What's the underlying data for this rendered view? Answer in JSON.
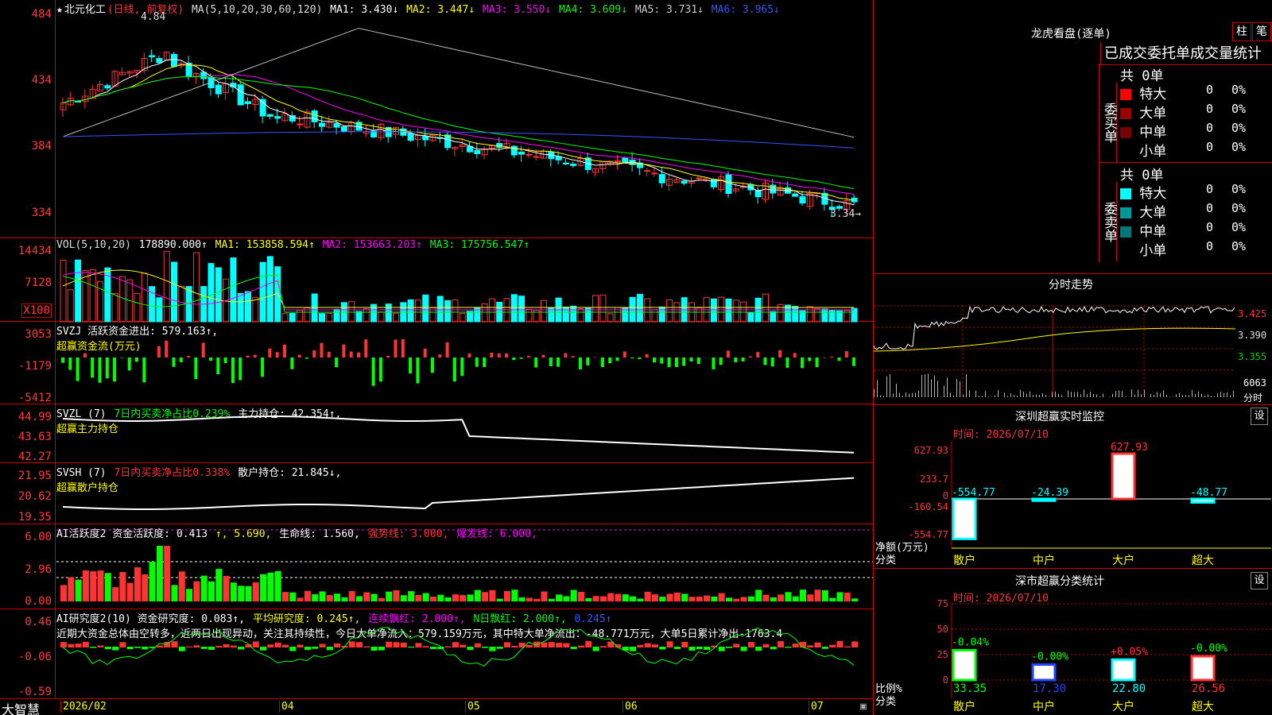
{
  "stock": {
    "name": "北元化工",
    "period": "(日线, 前复权)",
    "ma_label": "MA(5,10,20,30,60,120)",
    "ma_items": [
      {
        "t": "MA1: 3.430↓",
        "c": "#ffffff"
      },
      {
        "t": "MA2: 3.447↓",
        "c": "#ffff00"
      },
      {
        "t": "MA3: 3.550↓",
        "c": "#ff00ff"
      },
      {
        "t": "MA4: 3.609↓",
        "c": "#00ff00"
      },
      {
        "t": "MA5: 3.731↓",
        "c": "#cccccc"
      },
      {
        "t": "MA6: 3.965↓",
        "c": "#3355ff"
      }
    ],
    "hi_label": "4.84",
    "lo_label": "3.34→",
    "yticks": [
      "484",
      "434",
      "384",
      "334"
    ]
  },
  "vol": {
    "label": "VOL(5,10,20)",
    "val": "178890.000↑",
    "items": [
      {
        "t": "MA1: 153858.594↑",
        "c": "#ffff00"
      },
      {
        "t": "MA2: 153663.203↑",
        "c": "#ff00ff"
      },
      {
        "t": "MA3: 175756.547↑",
        "c": "#00ff00"
      }
    ],
    "yticks": [
      "14434",
      "7128"
    ],
    "unit": "X100"
  },
  "svzj": {
    "label": "SVZJ  活跃资金进出: 579.163↑,",
    "sub": "超赢资金流(万元)",
    "yticks": [
      "3053",
      "-1179",
      "-5412"
    ]
  },
  "svzl": {
    "label": "SVZL (7)",
    "green": "7日内买卖净占比0.239%",
    "main": "主力持仓: 42.354↑,",
    "sub": "超赢主力持仓",
    "yticks": [
      "44.99",
      "43.63",
      "42.27"
    ]
  },
  "svsh": {
    "label": "SVSH (7)",
    "red": "7日内买卖净占比0.338%",
    "main": "散户持仓: 21.845↓,",
    "sub": "超赢散户持仓",
    "yticks": [
      "21.95",
      "20.62",
      "19.35"
    ]
  },
  "ai1": {
    "label": "AI活跃度2 资金活跃度: 0.413",
    "items": [
      {
        "t": "↑, 5.690,",
        "c": "#ffff00"
      },
      {
        "t": "生命线: 1.560,",
        "c": "#ffffff"
      },
      {
        "t": "强势线: 3.000,",
        "c": "#ff3333"
      },
      {
        "t": "爆发线: 6.000,",
        "c": "#ff00ff"
      }
    ],
    "yticks": [
      "6.00",
      "2.96",
      "0.00"
    ]
  },
  "ai2": {
    "label": "AI研究度2(10) 资金研究度: 0.083↑,",
    "items": [
      {
        "t": "平均研究度: 0.245↑,",
        "c": "#ffff00"
      },
      {
        "t": "连续飘红: 2.000↑,",
        "c": "#ff00ff"
      },
      {
        "t": "N日飘红: 2.000↑,",
        "c": "#00ff00"
      },
      {
        "t": "0.245↑",
        "c": "#3355ff"
      }
    ],
    "comment": "近期大资金总体由空转多，近两日出现异动，关注其持续性，今日大单净流入：579.159万元，其中特大单净流出：-48.771万元，大单5日累计净出-1763.4",
    "yticks": [
      "0.46",
      "-0.06",
      "-0.59"
    ]
  },
  "xaxis": {
    "brand": "大智慧",
    "labels": [
      "2026/02",
      "04",
      "05",
      "06",
      "07"
    ]
  },
  "lhb": {
    "title": "龙虎看盘(逐单)",
    "tab1": "柱",
    "tab2": "笔",
    "header": "已成交委托单成交量统计",
    "buy": {
      "side": "委买单",
      "total": "共 0单",
      "rows": [
        {
          "n": "特大",
          "v": "0",
          "p": "0%",
          "c": "#ff0000"
        },
        {
          "n": "大单",
          "v": "0",
          "p": "0%",
          "c": "#990000"
        },
        {
          "n": "中单",
          "v": "0",
          "p": "0%",
          "c": "#770000"
        },
        {
          "n": "小单",
          "v": "0",
          "p": "0%",
          "c": "#000000"
        }
      ]
    },
    "sell": {
      "side": "委卖单",
      "total": "共 0单",
      "rows": [
        {
          "n": "特大",
          "v": "0",
          "p": "0%",
          "c": "#00ffff"
        },
        {
          "n": "大单",
          "v": "0",
          "p": "0%",
          "c": "#009999"
        },
        {
          "n": "中单",
          "v": "0",
          "p": "0%",
          "c": "#007777"
        },
        {
          "n": "小单",
          "v": "0",
          "p": "0%",
          "c": "#000000"
        }
      ]
    }
  },
  "fenshi": {
    "title": "分时走势",
    "yticks": [
      "3.425",
      "3.390",
      "3.355"
    ],
    "vol": "6063",
    "label": "分时"
  },
  "sz_monitor": {
    "title": "深圳超赢实时监控",
    "set": "设",
    "time": "时间: 2026/07/10",
    "yticks": [
      "627.93",
      "233.7",
      "0",
      "-160.54",
      "-554.77"
    ],
    "bars": [
      {
        "cat": "散户",
        "v": "-554.77",
        "cc": "#00ffff",
        "num": -554.77
      },
      {
        "cat": "中户",
        "v": "-24.39",
        "cc": "#00ffff",
        "num": -24.39
      },
      {
        "cat": "大户",
        "v": "627.93",
        "cc": "#ff3333",
        "num": 627.93
      },
      {
        "cat": "超大",
        "v": "-48.77",
        "cc": "#00ffff",
        "num": -48.77
      }
    ],
    "side1": "净额(万元)",
    "side2": "分类"
  },
  "sz_class": {
    "title": "深市超赢分类统计",
    "set": "设",
    "time": "时间: 2026/07/10",
    "yticks": [
      "75",
      "50",
      "25",
      "0"
    ],
    "bars": [
      {
        "cat": "散户",
        "top": "-0.04%",
        "tc": "#00ff00",
        "bot": "33.35",
        "col": "#00ff00",
        "num": 33.35
      },
      {
        "cat": "中户",
        "top": "-0.00%",
        "tc": "#00ff00",
        "bot": "17.30",
        "col": "#2244ff",
        "num": 17.3
      },
      {
        "cat": "大户",
        "top": "+0.05%",
        "tc": "#ff3333",
        "bot": "22.80",
        "col": "#00ffff",
        "num": 22.8
      },
      {
        "cat": "超大",
        "top": "-0.00%",
        "tc": "#00ff00",
        "bot": "26.56",
        "col": "#ff3333",
        "num": 26.56
      }
    ],
    "side1": "比例%",
    "side2": "分类"
  }
}
